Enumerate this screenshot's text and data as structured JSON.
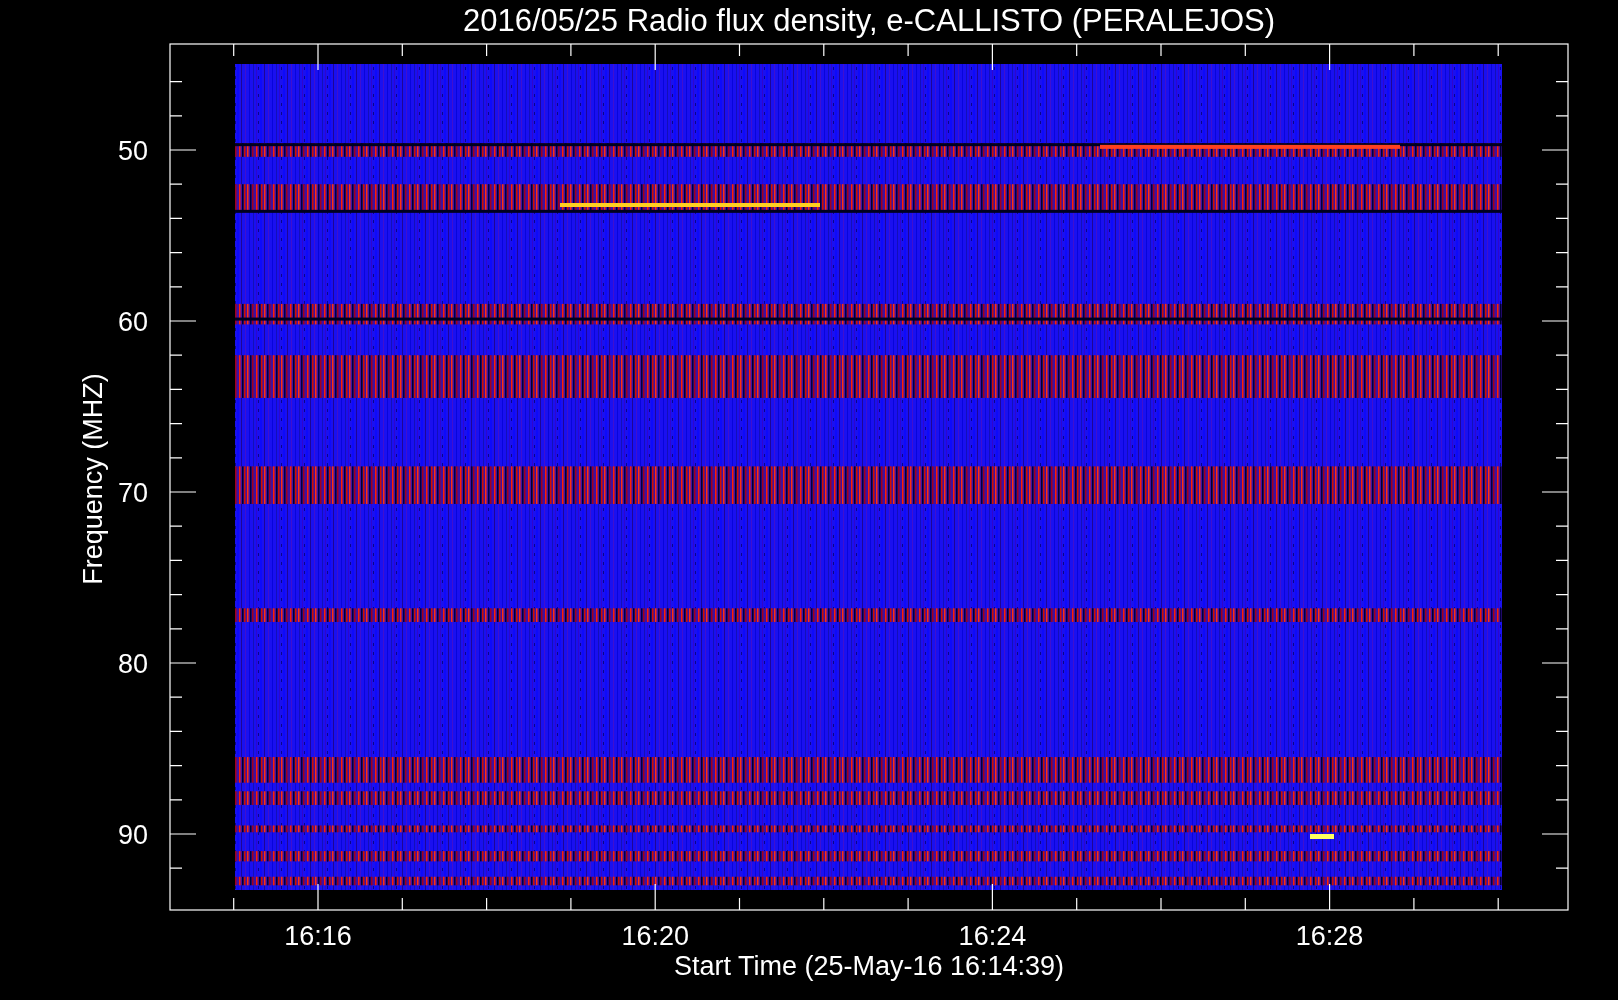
{
  "title": "2016/05/25  Radio flux density, e-CALLISTO (PERALEJOS)",
  "plot": {
    "ylabel": "Frequency (MHZ)",
    "xlabel": "Start Time (25-May-16 16:14:39)",
    "yticks": [
      "50",
      "60",
      "70",
      "80",
      "90"
    ],
    "xticks": [
      "16:16",
      "16:20",
      "16:24",
      "16:28"
    ]
  }
}
